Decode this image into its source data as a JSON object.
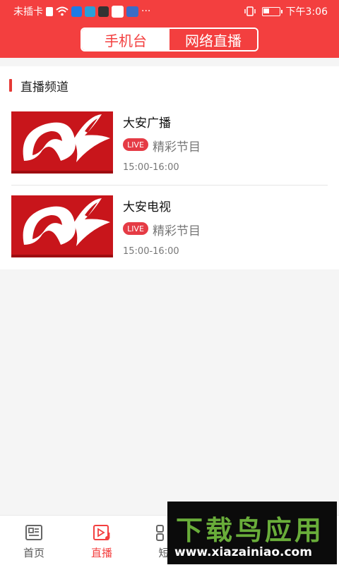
{
  "status_bar": {
    "carrier": "未插卡",
    "time": "下午3:06"
  },
  "header": {
    "tabs": [
      {
        "label": "手机台",
        "active": true
      },
      {
        "label": "网络直播",
        "active": false
      }
    ]
  },
  "section": {
    "title": "直播频道"
  },
  "channels": [
    {
      "name": "大安广播",
      "badge": "LIVE",
      "program": "精彩节目",
      "time": "15:00-16:00"
    },
    {
      "name": "大安电视",
      "badge": "LIVE",
      "program": "精彩节目",
      "time": "15:00-16:00"
    }
  ],
  "bottom_nav": [
    {
      "label": "首页",
      "icon": "news-icon",
      "active": false
    },
    {
      "label": "直播",
      "icon": "live-play-icon",
      "active": true
    },
    {
      "label": "短",
      "icon": "grid-icon",
      "active": false
    }
  ],
  "watermark": {
    "title": "下载鸟应用",
    "url": "www.xiazainiao.com"
  },
  "colors": {
    "brand_red": "#f33f3f",
    "live_badge": "#e53b45"
  }
}
